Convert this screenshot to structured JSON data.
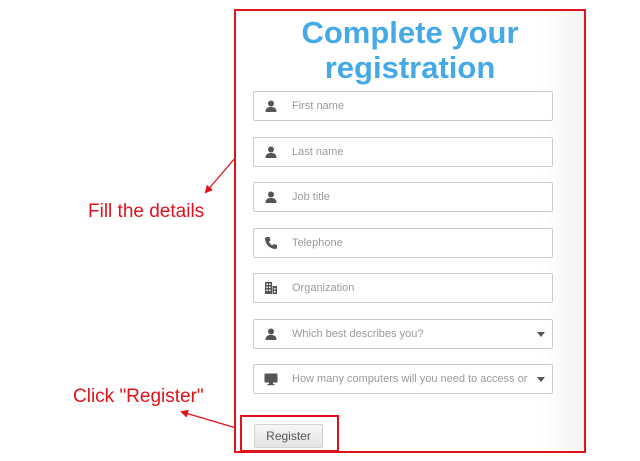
{
  "form": {
    "title_line1": "Complete your",
    "title_line2": "registration",
    "fields": [
      {
        "placeholder": "First name",
        "icon": "person-icon"
      },
      {
        "placeholder": "Last name",
        "icon": "person-icon"
      },
      {
        "placeholder": "Job title",
        "icon": "person-icon"
      },
      {
        "placeholder": "Telephone",
        "icon": "phone-icon"
      },
      {
        "placeholder": "Organization",
        "icon": "building-icon"
      }
    ],
    "selects": [
      {
        "text": "Which best describes you?",
        "icon": "person-icon"
      },
      {
        "text": "How many computers will you need to access or s",
        "icon": "monitor-icon"
      }
    ],
    "register_label": "Register"
  },
  "annotations": {
    "fill_details": "Fill the details",
    "click_register": "Click \"Register\""
  },
  "colors": {
    "accent": "#45a9e8",
    "annotation": "#e0121b"
  }
}
